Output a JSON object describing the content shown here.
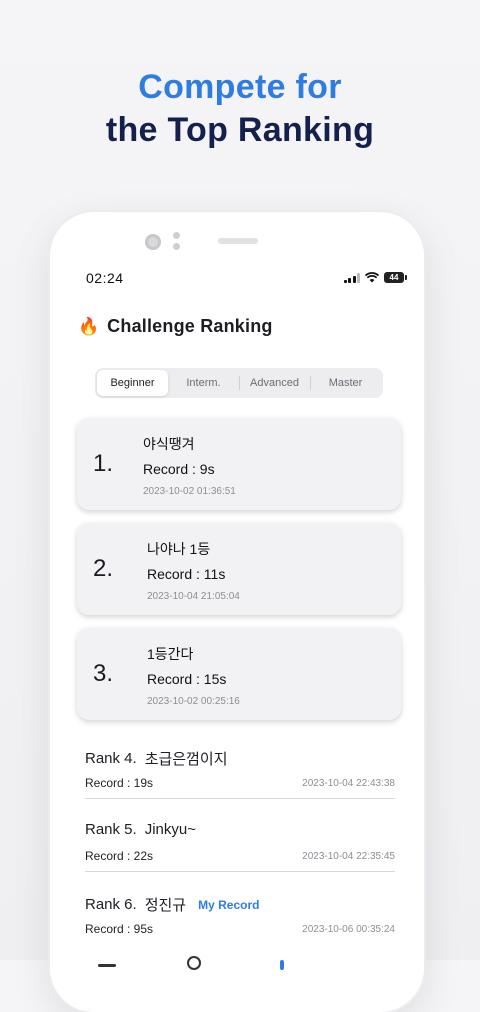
{
  "headline": {
    "line1": "Compete for",
    "line2": "the Top Ranking"
  },
  "status": {
    "time": "02:24",
    "battery": "44"
  },
  "page": {
    "fire_icon": "🔥",
    "title": "Challenge Ranking"
  },
  "tabs": [
    {
      "label": "Beginner",
      "active": true
    },
    {
      "label": "Interm.",
      "active": false
    },
    {
      "label": "Advanced",
      "active": false
    },
    {
      "label": "Master",
      "active": false
    }
  ],
  "top3": [
    {
      "rank": "1.",
      "name": "야식땡겨",
      "record": "Record : 9s",
      "date": "2023-10-02 01:36:51"
    },
    {
      "rank": "2.",
      "name": "나야나 1등",
      "record": "Record : 11s",
      "date": "2023-10-04 21:05:04"
    },
    {
      "rank": "3.",
      "name": "1등간다",
      "record": "Record : 15s",
      "date": "2023-10-02 00:25:16"
    }
  ],
  "list": [
    {
      "rank": "Rank 4.",
      "name": "초급은껌이지",
      "record": "Record : 19s",
      "date": "2023-10-04 22:43:38",
      "tag": ""
    },
    {
      "rank": "Rank 5.",
      "name": "Jinkyu~",
      "record": "Record : 22s",
      "date": "2023-10-04 22:35:45",
      "tag": ""
    },
    {
      "rank": "Rank 6.",
      "name": "정진규",
      "record": "Record : 95s",
      "date": "2023-10-06 00:35:24",
      "tag": "My Record"
    }
  ],
  "colors": {
    "accent": "#2f7de1",
    "headline_dark": "#16204d"
  }
}
